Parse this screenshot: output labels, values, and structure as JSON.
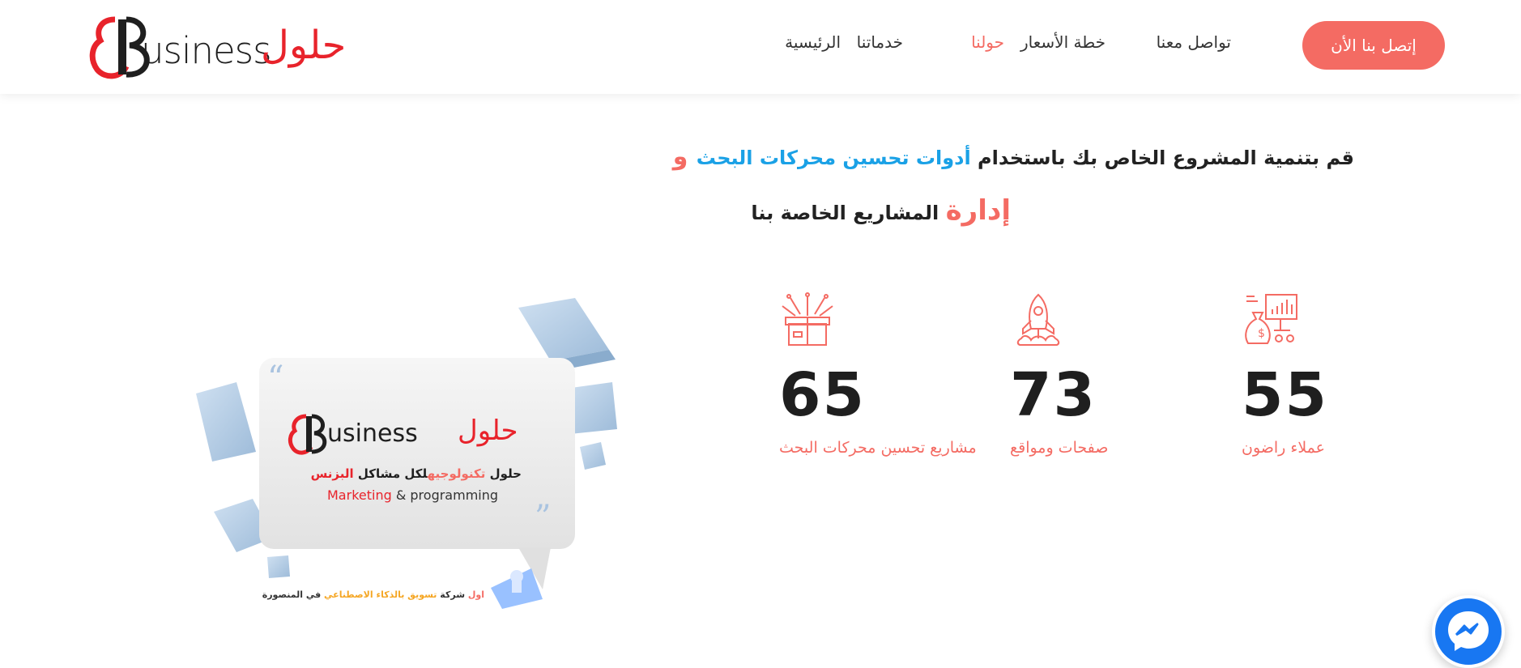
{
  "header": {
    "logo": {
      "latin": "usiness",
      "arabic": "حلول"
    },
    "nav": [
      {
        "label": "تواصل معنا",
        "active": false
      },
      {
        "label": "خطة الأسعار",
        "active": false
      },
      {
        "label": "حولنا",
        "active": true
      },
      {
        "label": "خدماتنا",
        "active": false
      },
      {
        "label": "الرئيسية",
        "active": false
      }
    ],
    "cta_label": "إتصل بنا الأن"
  },
  "hero": {
    "line1_start": "قم بتنمية المشروع الخاص بك باستخدام ",
    "line1_blue": "أدوات تحسين محركات البحث",
    "line1_and": " و",
    "line2_red": "إدارة",
    "line2_rest": " المشاريع الخاصة بنا"
  },
  "stats": [
    {
      "value": "65",
      "label": "مشاريع تحسين محركات البحث",
      "icon": "gift-box-icon"
    },
    {
      "value": "73",
      "label": "صفحات ومواقع",
      "icon": "rocket-icon"
    },
    {
      "value": "55",
      "label": "عملاء راضون",
      "icon": "money-bag-chart-icon"
    }
  ],
  "illustration": {
    "logo_latin": "usiness",
    "logo_arabic": "حلول",
    "tagline_ar_1": "حلول ",
    "tagline_ar_2": "تكنولوجيه",
    "tagline_ar_3": "لكل مشاكل ",
    "tagline_ar_4": "البزنس",
    "marketing": "Marketing",
    "programming": " & programming",
    "bottom_1": "اول ",
    "bottom_2": "شركة ",
    "bottom_3": "تسويق بالذكاء الاصطناعي ",
    "bottom_4": "في المنصورة"
  },
  "colors": {
    "accent": "#f46b63",
    "blue": "#1aa1e6",
    "logo_red": "#e8232b",
    "messenger": "#1877f2"
  }
}
